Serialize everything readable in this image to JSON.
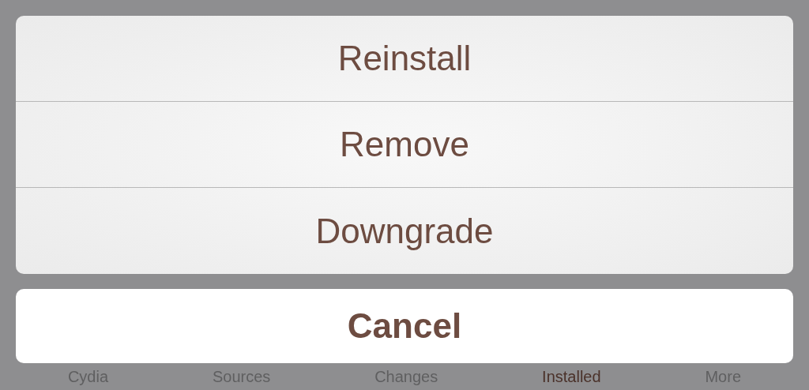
{
  "action_sheet": {
    "actions": [
      {
        "label": "Reinstall"
      },
      {
        "label": "Remove"
      },
      {
        "label": "Downgrade"
      }
    ],
    "cancel": {
      "label": "Cancel"
    }
  },
  "tab_bar": {
    "tabs": [
      {
        "label": "Cydia",
        "selected": false
      },
      {
        "label": "Sources",
        "selected": false
      },
      {
        "label": "Changes",
        "selected": false
      },
      {
        "label": "Installed",
        "selected": true
      },
      {
        "label": "More",
        "selected": false
      }
    ]
  }
}
